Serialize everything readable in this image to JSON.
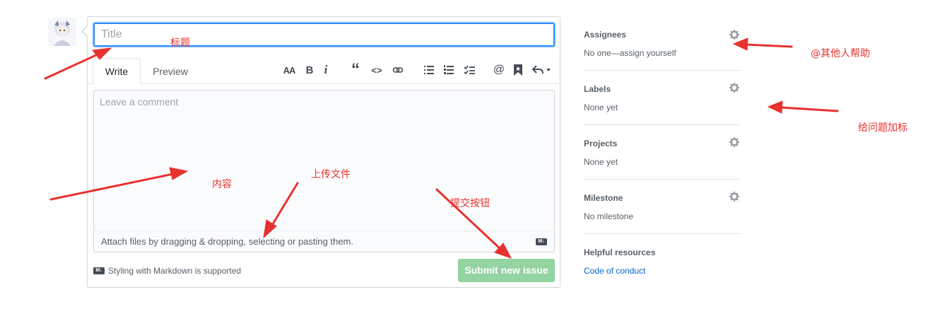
{
  "form": {
    "title_placeholder": "Title",
    "tabs": [
      {
        "label": "Write",
        "active": true
      },
      {
        "label": "Preview",
        "active": false
      }
    ],
    "comment_placeholder": "Leave a comment",
    "attach_text": "Attach files by dragging & dropping, selecting or pasting them.",
    "markdown_badge": "M↓",
    "styling_note": "Styling with Markdown is supported",
    "submit_label": "Submit new issue"
  },
  "toolbar": {
    "heading": "AA",
    "bold": "B",
    "italic": "i",
    "quote": "“",
    "code": "<>",
    "link": "link-icon",
    "ul": "ul-icon",
    "ol": "ol-icon",
    "tasklist": "tasklist-icon",
    "mention": "@",
    "saved_reply": "bookmark-icon",
    "reply": "reply-icon"
  },
  "sidebar": {
    "assignees": {
      "title": "Assignees",
      "value": "No one—assign yourself"
    },
    "labels": {
      "title": "Labels",
      "value": "None yet"
    },
    "projects": {
      "title": "Projects",
      "value": "None yet"
    },
    "milestone": {
      "title": "Milestone",
      "value": "No milestone"
    },
    "resources": {
      "title": "Helpful resources",
      "link": "Code of conduct"
    }
  },
  "annotations": {
    "title": "标题",
    "content": "内容",
    "upload": "上传文件",
    "submit": "提交按钮",
    "assign": "@其他人帮助",
    "labels": "给问题加标"
  },
  "colors": {
    "accent": "#2188ff",
    "submit_green": "#94d3a2",
    "link_blue": "#0366d6",
    "annotation_red": "#e8322f"
  }
}
